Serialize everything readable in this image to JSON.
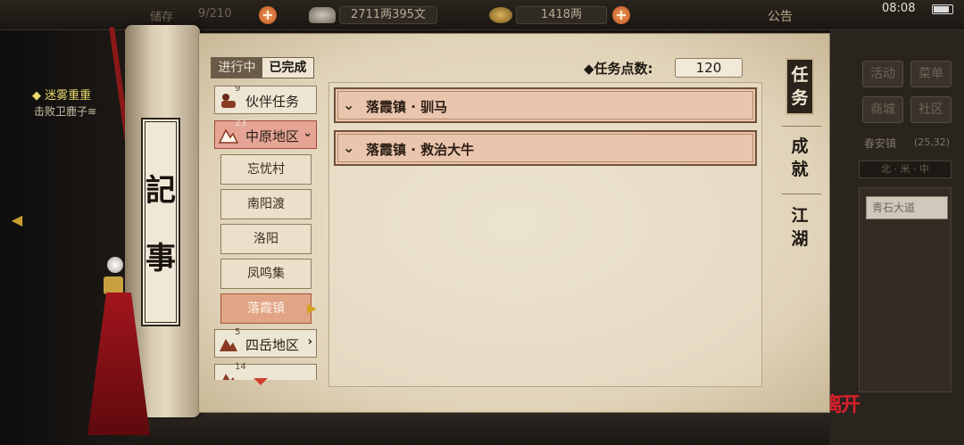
{
  "topbar": {
    "partial_left": "储存",
    "bag_count": "9/210",
    "silver": "2711两395文",
    "gold": "1418两",
    "notice": "公告",
    "clock": "08:08",
    "plus_symbol": "+"
  },
  "side_quest": {
    "title": "◆ 迷雾重重",
    "subtitle": "击败卫鹿子≋"
  },
  "scroll": {
    "char_1": "記",
    "char_2": "事"
  },
  "status_tabs": {
    "in_progress": "进行中",
    "completed": "已完成"
  },
  "categories": [
    {
      "label": "伙伴任务",
      "count": "9",
      "icon": "companion-icon"
    },
    {
      "label": "中原地区",
      "count": "23",
      "icon": "mountain-icon",
      "chevron": "⌄"
    },
    {
      "label": "四岳地区",
      "count": "5",
      "icon": "mountain-icon",
      "chevron": "›"
    },
    {
      "label": "",
      "count": "14",
      "icon": "mountain-icon"
    }
  ],
  "sub_locations": [
    "忘忧村",
    "南阳渡",
    "洛阳",
    "凤鸣集",
    "落霞镇"
  ],
  "quest_points": {
    "label": "◆任务点数:",
    "value": "120"
  },
  "quests": [
    {
      "title": "落霞镇 · 驯马"
    },
    {
      "title": "落霞镇 · 救治大牛"
    }
  ],
  "vertical_tabs": [
    {
      "label": "任务",
      "active": true
    },
    {
      "label": "成就",
      "active": false
    },
    {
      "label": "江湖",
      "active": false
    }
  ],
  "right_panel": {
    "buttons": [
      "活动",
      "菜单",
      "商城",
      "社区"
    ],
    "location": "春安镇",
    "coords": "(25,32)",
    "compass": "北 · 米 · 中",
    "road": "青石大道",
    "exit": "离开"
  },
  "colors": {
    "parchment": "#e7dcc4",
    "quest_row": "#e9c5ad",
    "selected_location": "#e2a486",
    "tassel": "#a3151c"
  }
}
